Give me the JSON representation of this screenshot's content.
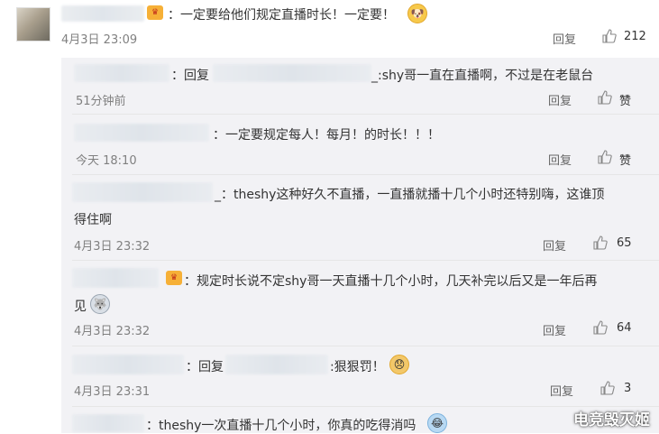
{
  "main_comment": {
    "text": "：一定要给他们规定直播时长！一定要！",
    "time": "4月3日 23:09",
    "reply_label": "回复",
    "likes": "212"
  },
  "replies": [
    {
      "prefix": "：回复",
      "text": "_:shy哥一直在直播啊，不过是在老鼠台",
      "time": "51分钟前",
      "reply_label": "回复",
      "likes": "赞"
    },
    {
      "text": "：一定要规定每人！每月！的时长！！！",
      "time": "今天 18:10",
      "reply_label": "回复",
      "likes": "赞"
    },
    {
      "text_line1": "_：theshy这种好久不直播，一直播就播十几个小时还特别嗨，这谁顶",
      "text_line2": "得住啊",
      "time": "4月3日 23:32",
      "reply_label": "回复",
      "likes": "65"
    },
    {
      "text_line1": "：规定时长说不定shy哥一天直播十几个小时，几天补完以后又是一年后再",
      "text_line2": "见",
      "time": "4月3日 23:32",
      "reply_label": "回复",
      "likes": "64"
    },
    {
      "prefix": "：回复",
      "text": ":狠狠罚！",
      "time": "4月3日 23:31",
      "reply_label": "回复",
      "likes": "3"
    },
    {
      "text": "：theshy一次直播十几个小时，你真的吃得消吗"
    }
  ],
  "watermark": "电竞毁灭姬"
}
